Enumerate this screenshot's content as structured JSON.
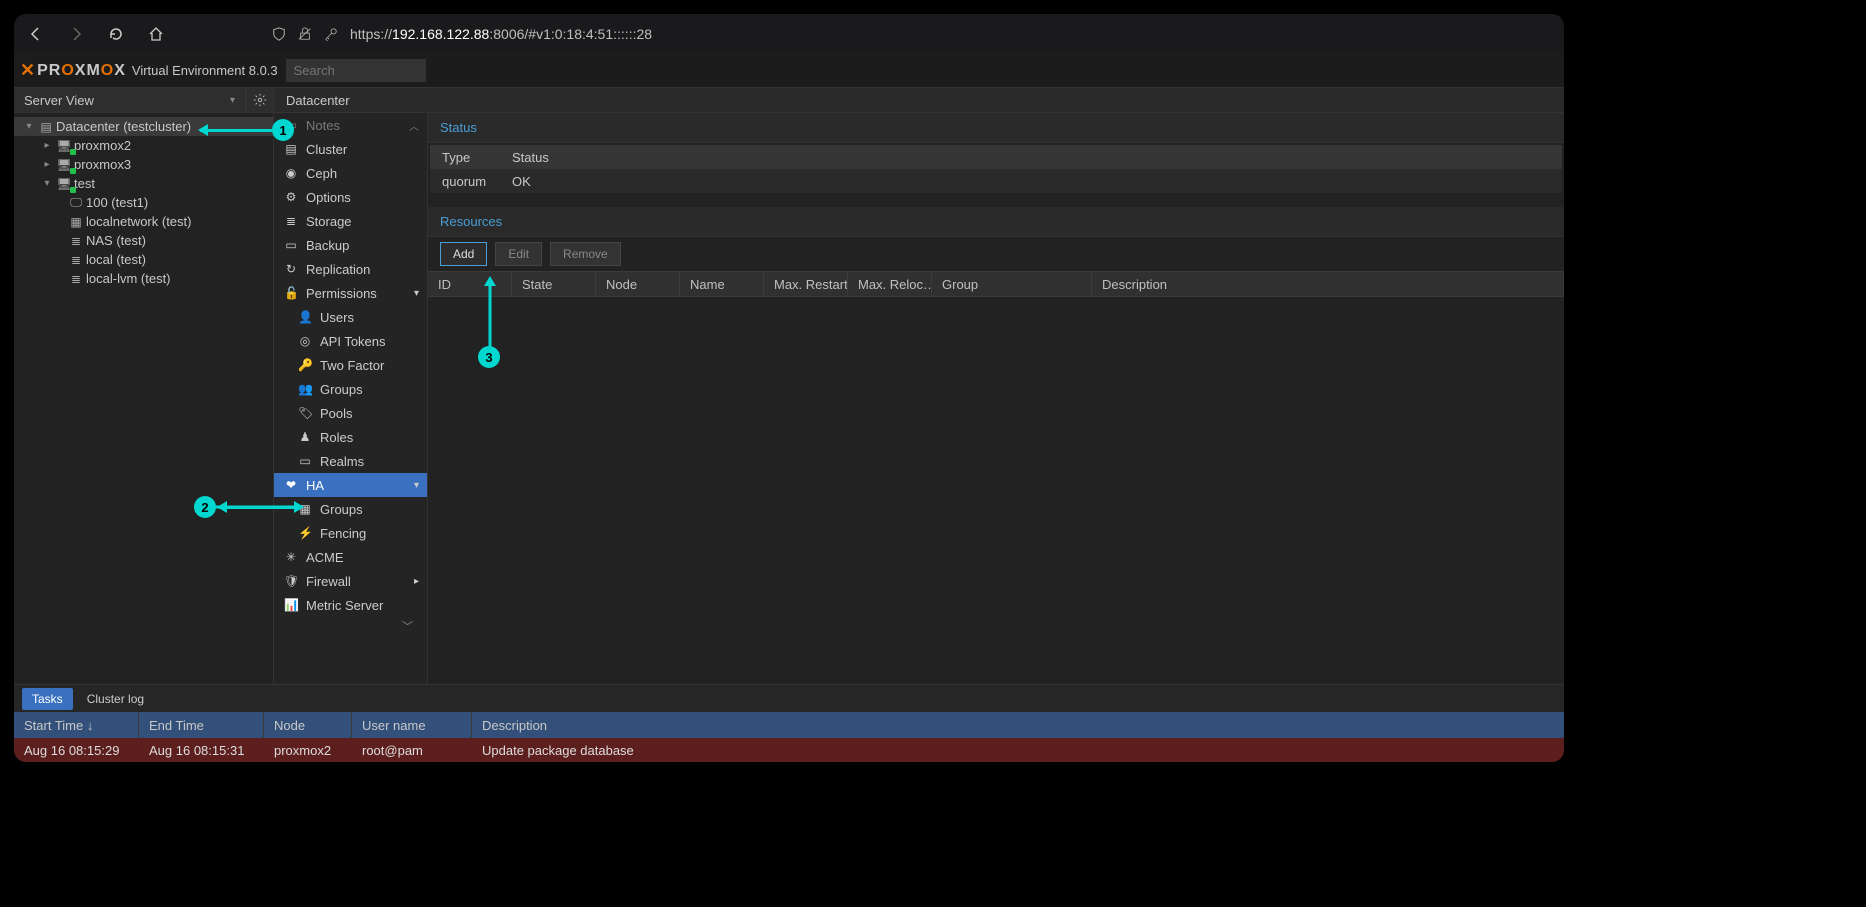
{
  "browser": {
    "url_prefix": "https://",
    "url_host": "192.168.122.88",
    "url_rest": ":8006/#v1:0:18:4:51::::::28"
  },
  "header": {
    "product": "PROXMOX",
    "subtitle": "Virtual Environment 8.0.3",
    "search_placeholder": "Search"
  },
  "server_view_label": "Server View",
  "breadcrumb": "Datacenter",
  "tree": {
    "root": "Datacenter (testcluster)",
    "nodes": [
      "proxmox2",
      "proxmox3",
      "test"
    ],
    "test_children": [
      "100 (test1)",
      "localnetwork (test)",
      "NAS (test)",
      "local (test)",
      "local-lvm (test)"
    ]
  },
  "nav": {
    "notes": "Notes",
    "cluster": "Cluster",
    "ceph": "Ceph",
    "options": "Options",
    "storage": "Storage",
    "backup": "Backup",
    "replication": "Replication",
    "permissions": "Permissions",
    "users": "Users",
    "api_tokens": "API Tokens",
    "two_factor": "Two Factor",
    "groups": "Groups",
    "pools": "Pools",
    "roles": "Roles",
    "realms": "Realms",
    "ha": "HA",
    "ha_groups": "Groups",
    "fencing": "Fencing",
    "acme": "ACME",
    "firewall": "Firewall",
    "metric": "Metric Server"
  },
  "main": {
    "status_title": "Status",
    "status_col_type": "Type",
    "status_col_status": "Status",
    "status_row_type": "quorum",
    "status_row_status": "OK",
    "resources_title": "Resources",
    "btn_add": "Add",
    "btn_edit": "Edit",
    "btn_remove": "Remove",
    "cols": {
      "id": "ID",
      "state": "State",
      "node": "Node",
      "name": "Name",
      "max_restart": "Max. Restart",
      "max_reloc": "Max. Reloc…",
      "group": "Group",
      "description": "Description"
    }
  },
  "tasks": {
    "tab_tasks": "Tasks",
    "tab_cluster_log": "Cluster log",
    "cols": {
      "start": "Start Time ↓",
      "end": "End Time",
      "node": "Node",
      "user": "User name",
      "desc": "Description"
    },
    "row": {
      "start": "Aug 16 08:15:29",
      "end": "Aug 16 08:15:31",
      "node": "proxmox2",
      "user": "root@pam",
      "desc": "Update package database"
    }
  },
  "annotations": {
    "a1": "1",
    "a2": "2",
    "a3": "3"
  }
}
